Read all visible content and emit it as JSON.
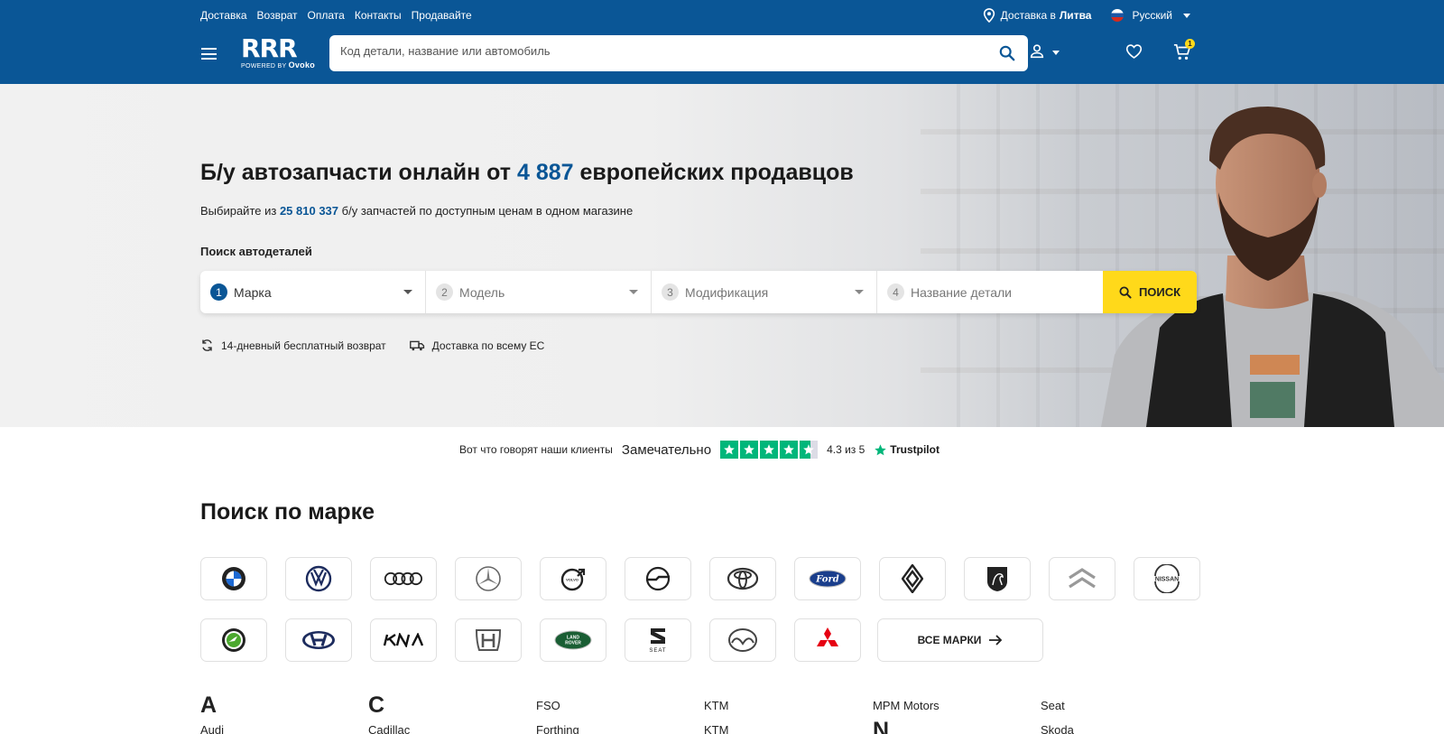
{
  "topnav": [
    "Доставка",
    "Возврат",
    "Оплата",
    "Контакты",
    "Продавайте"
  ],
  "delivery": {
    "prefix": "Доставка в",
    "country": "Литва"
  },
  "language": "Русский",
  "logo": {
    "mark": "RRR",
    "powered": "POWERED BY",
    "brand": "Ovoko"
  },
  "search": {
    "placeholder": "Код детали, название или автомобиль"
  },
  "cart": {
    "count": "1"
  },
  "hero": {
    "title_pre": "Б/у автозапчасти онлайн от",
    "title_num": "4 887",
    "title_post": "европейских продавцов",
    "sub_pre": "Выбирайте из",
    "sub_num": "25 810 337",
    "sub_post": "б/у запчастей по доступным ценам в одном магазине",
    "label": "Поиск автодеталей"
  },
  "finder": {
    "fields": [
      {
        "n": "1",
        "label": "Марка"
      },
      {
        "n": "2",
        "label": "Модель"
      },
      {
        "n": "3",
        "label": "Модификация"
      },
      {
        "n": "4",
        "label": "Название детали"
      }
    ],
    "button": "ПОИСК"
  },
  "perks": [
    "14-дневный бесплатный возврат",
    "Доставка по всему ЕС"
  ],
  "trustpilot": {
    "intro": "Вот что говорят наши клиенты",
    "rating_word": "Замечательно",
    "score": "4.3 из 5",
    "brand": "Trustpilot",
    "stars": 4.3
  },
  "brands": {
    "heading": "Поиск по марке",
    "row1": [
      "BMW",
      "Volkswagen",
      "Audi",
      "Mercedes-Benz",
      "Volvo",
      "Opel",
      "Toyota",
      "Ford",
      "Renault",
      "Peugeot",
      "Citroen",
      "Nissan"
    ],
    "row2": [
      "Skoda",
      "Hyundai",
      "Kia",
      "Honda",
      "Land Rover",
      "Seat",
      "Mazda",
      "Mitsubishi"
    ],
    "all_label": "ВСЕ МАРКИ",
    "ford_text": "Ford",
    "nissan_text": "NISSAN",
    "seat_text": "SEAT",
    "kia_text": "KIA",
    "lr_text1": "LAND",
    "lr_text2": "ROVER"
  },
  "alpha": [
    {
      "letter": "A",
      "items": [
        "Audi"
      ]
    },
    {
      "letter": "C",
      "items": [
        "Cadillac"
      ]
    },
    {
      "letter": "",
      "items": [
        "FSO",
        "Forthing"
      ]
    },
    {
      "letter": "",
      "items": [
        "KTM",
        "KTM"
      ]
    },
    {
      "letter": "",
      "items": [
        "MPM Motors"
      ],
      "next_letter": "N"
    },
    {
      "letter": "",
      "items": [
        "Seat",
        "Skoda"
      ]
    }
  ],
  "colors": {
    "header": "#0a5696",
    "accent": "#ffd91a",
    "trustpilot": "#00b67a"
  }
}
